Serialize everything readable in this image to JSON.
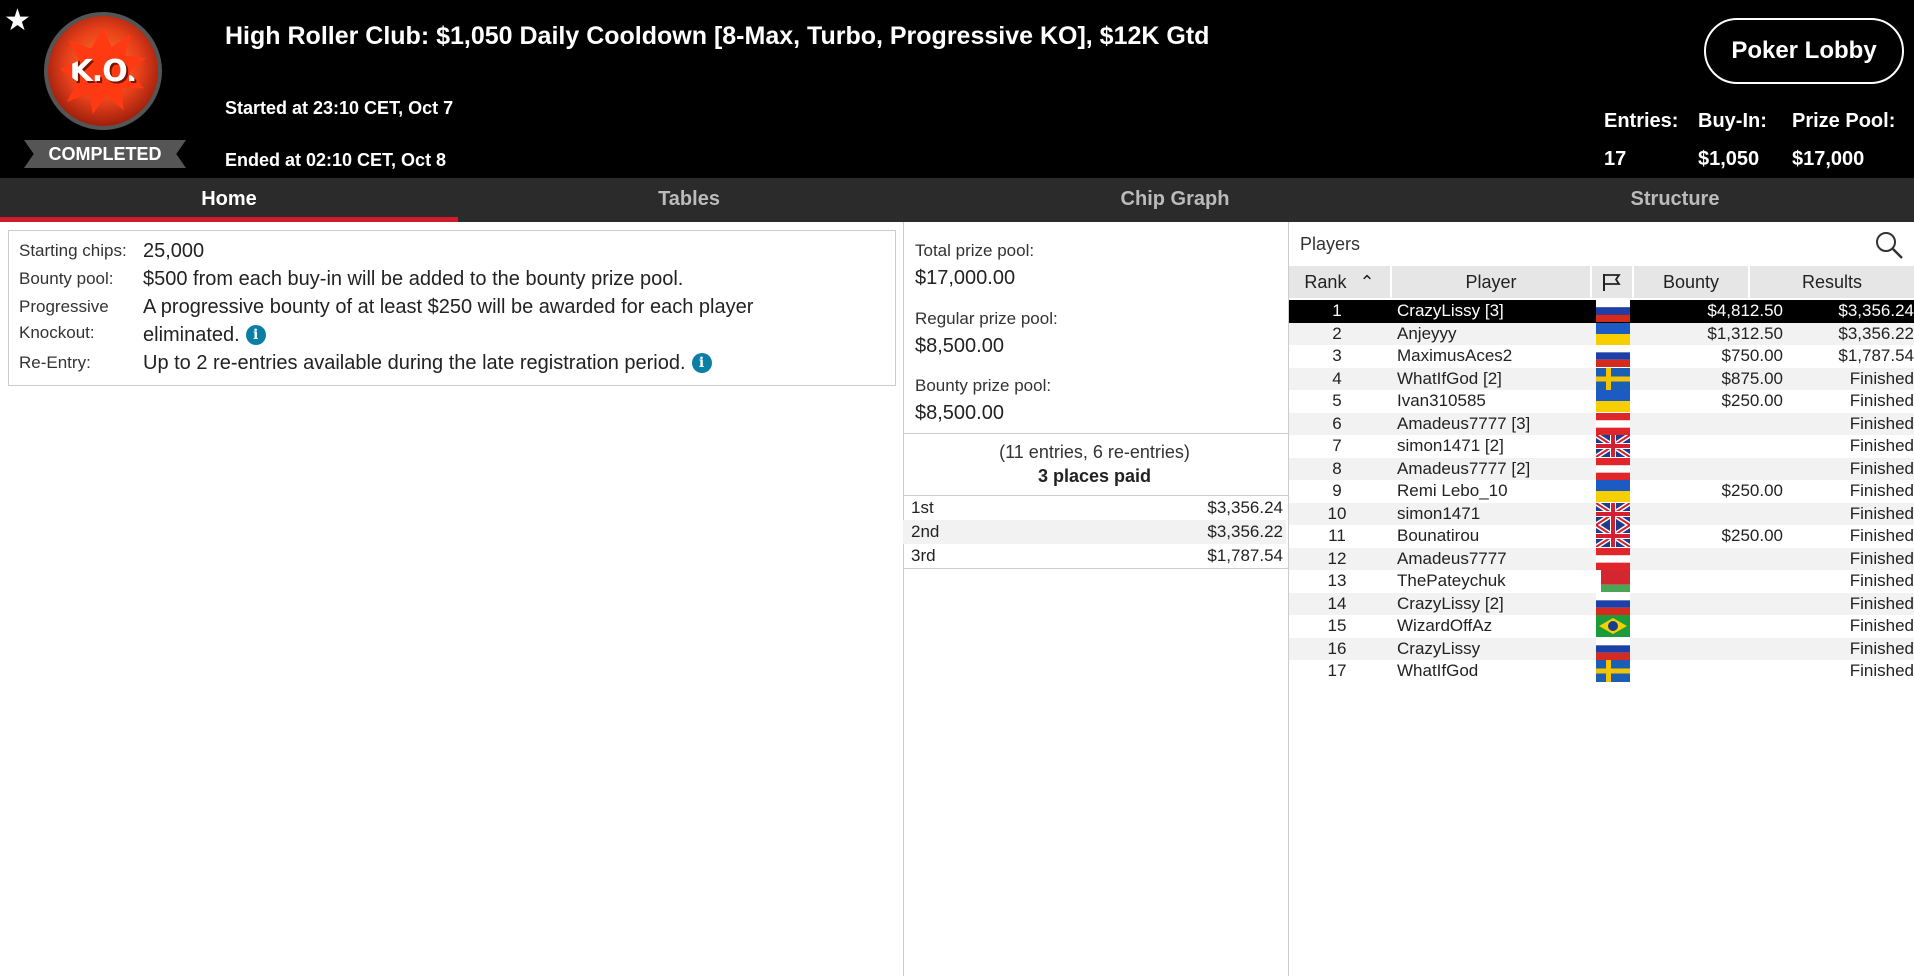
{
  "header": {
    "ko_logo_text": "K.O.",
    "status": "COMPLETED",
    "title": "High Roller Club: $1,050 Daily Cooldown [8-Max, Turbo, Progressive KO], $12K Gtd",
    "started": "Started at 23:10 CET, Oct 7",
    "ended": "Ended at 02:10 CET, Oct 8",
    "lobby_button": "Poker Lobby",
    "stats": [
      {
        "label": "Entries:",
        "value": "17"
      },
      {
        "label": "Buy-In:",
        "value": "$1,050"
      },
      {
        "label": "Prize Pool:",
        "value": "$17,000"
      }
    ]
  },
  "tabs": [
    {
      "label": "Home",
      "active": true
    },
    {
      "label": "Tables",
      "active": false
    },
    {
      "label": "Chip Graph",
      "active": false
    },
    {
      "label": "Structure",
      "active": false
    }
  ],
  "info": {
    "starting_chips_label": "Starting chips:",
    "starting_chips_value": "25,000",
    "bounty_pool_label": "Bounty pool:",
    "bounty_pool_value": "$500 from each buy-in will be added to the bounty prize pool.",
    "progressive_label_1": "Progressive",
    "progressive_label_2": "Knockout:",
    "progressive_value_1": "A progressive bounty of at least $250 will be awarded for each player",
    "progressive_value_2": "eliminated.",
    "reentry_label": "Re-Entry:",
    "reentry_value": "Up to 2 re-entries available during the late registration period.",
    "info_icon": "i"
  },
  "prize": {
    "total_label": "Total prize pool:",
    "total_value": "$17,000.00",
    "regular_label": "Regular prize pool:",
    "regular_value": "$8,500.00",
    "bounty_label": "Bounty prize pool:",
    "bounty_value": "$8,500.00",
    "entries_note": "(11 entries, 6 re-entries)",
    "places_paid": "3 places paid",
    "payouts": [
      {
        "place": "1st",
        "amount": "$3,356.24"
      },
      {
        "place": "2nd",
        "amount": "$3,356.22"
      },
      {
        "place": "3rd",
        "amount": "$1,787.54"
      }
    ]
  },
  "players_panel": {
    "title": "Players",
    "columns": {
      "rank": "Rank",
      "player": "Player",
      "bounty": "Bounty",
      "results": "Results"
    },
    "rows": [
      {
        "rank": "1",
        "player": "CrazyLissy [3]",
        "flag": "ru",
        "bounty": "$4,812.50",
        "result": "$3,356.24"
      },
      {
        "rank": "2",
        "player": "Anjeyyy",
        "flag": "ua",
        "bounty": "$1,312.50",
        "result": "$3,356.22"
      },
      {
        "rank": "3",
        "player": "MaximusAces2",
        "flag": "ru",
        "bounty": "$750.00",
        "result": "$1,787.54"
      },
      {
        "rank": "4",
        "player": "WhatIfGod [2]",
        "flag": "se",
        "bounty": "$875.00",
        "result": "Finished"
      },
      {
        "rank": "5",
        "player": "Ivan310585",
        "flag": "ua",
        "bounty": "$250.00",
        "result": "Finished"
      },
      {
        "rank": "6",
        "player": "Amadeus7777 [3]",
        "flag": "at",
        "bounty": "",
        "result": "Finished"
      },
      {
        "rank": "7",
        "player": "simon1471 [2]",
        "flag": "gb",
        "bounty": "",
        "result": "Finished"
      },
      {
        "rank": "8",
        "player": "Amadeus7777 [2]",
        "flag": "at",
        "bounty": "",
        "result": "Finished"
      },
      {
        "rank": "9",
        "player": "Remi Lebo_10",
        "flag": "ua",
        "bounty": "$250.00",
        "result": "Finished"
      },
      {
        "rank": "10",
        "player": "simon1471",
        "flag": "gb",
        "bounty": "",
        "result": "Finished"
      },
      {
        "rank": "11",
        "player": "Bounatirou",
        "flag": "gb",
        "bounty": "$250.00",
        "result": "Finished"
      },
      {
        "rank": "12",
        "player": "Amadeus7777",
        "flag": "at",
        "bounty": "",
        "result": "Finished"
      },
      {
        "rank": "13",
        "player": "ThePateychuk",
        "flag": "by",
        "bounty": "",
        "result": "Finished"
      },
      {
        "rank": "14",
        "player": "CrazyLissy [2]",
        "flag": "ru",
        "bounty": "",
        "result": "Finished"
      },
      {
        "rank": "15",
        "player": "WizardOffAz",
        "flag": "br",
        "bounty": "",
        "result": "Finished"
      },
      {
        "rank": "16",
        "player": "CrazyLissy",
        "flag": "ru",
        "bounty": "",
        "result": "Finished"
      },
      {
        "rank": "17",
        "player": "WhatIfGod",
        "flag": "se",
        "bounty": "",
        "result": "Finished"
      }
    ],
    "selected_rank": "1"
  },
  "colors": {
    "header_bg": "#000000",
    "tab_bar_bg": "#2b2b2b",
    "tab_active_underline": "#d11a2a",
    "info_icon": "#0a7fa6",
    "selected_row_bg": "#000000"
  }
}
